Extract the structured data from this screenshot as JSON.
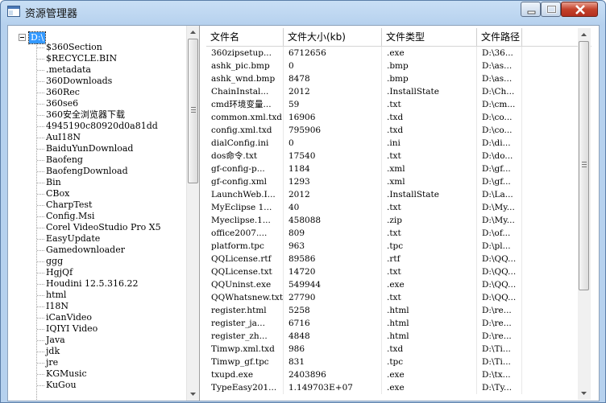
{
  "window": {
    "title": "资源管理器"
  },
  "tree": {
    "root": "D:\\",
    "items": [
      "$360Section",
      "$RECYCLE.BIN",
      ".metadata",
      "360Downloads",
      "360Rec",
      "360se6",
      "360安全浏览器下载",
      "4945190c80920d0a81dd",
      "AuI18N",
      "BaiduYunDownload",
      "Baofeng",
      "BaofengDownload",
      "Bin",
      "CBox",
      "CharpTest",
      "Config.Msi",
      "Corel VideoStudio Pro X5",
      "EasyUpdate",
      "Gamedownloader",
      "ggg",
      "HgjQf",
      "Houdini 12.5.316.22",
      "html",
      "I18N",
      "iCanVideo",
      "IQIYI Video",
      "Java",
      "jdk",
      "jre",
      "KGMusic",
      "KuGou"
    ]
  },
  "grid": {
    "columns": [
      "文件名",
      "文件大小(kb)",
      "文件类型",
      "文件路径"
    ],
    "rows": [
      [
        "360zipsetup...",
        "6712656",
        ".exe",
        "D:\\36..."
      ],
      [
        "ashk_pic.bmp",
        "0",
        ".bmp",
        "D:\\as..."
      ],
      [
        "ashk_wnd.bmp",
        "8478",
        ".bmp",
        "D:\\as..."
      ],
      [
        "ChainInstal...",
        "2012",
        ".InstallState",
        "D:\\Ch..."
      ],
      [
        "cmd环境变量...",
        "59",
        ".txt",
        "D:\\cm..."
      ],
      [
        "common.xml.txd",
        "16906",
        ".txd",
        "D:\\co..."
      ],
      [
        "config.xml.txd",
        "795906",
        ".txd",
        "D:\\co..."
      ],
      [
        "dialConfig.ini",
        "0",
        ".ini",
        "D:\\di..."
      ],
      [
        "dos命令.txt",
        "17540",
        ".txt",
        "D:\\do..."
      ],
      [
        "gf-config-p...",
        "1184",
        ".xml",
        "D:\\gf..."
      ],
      [
        "gf-config.xml",
        "1293",
        ".xml",
        "D:\\gf..."
      ],
      [
        "LaunchWeb.I...",
        "2012",
        ".InstallState",
        "D:\\La..."
      ],
      [
        "MyEclipse 1...",
        "40",
        ".txt",
        "D:\\My..."
      ],
      [
        "Myeclipse.1...",
        "458088",
        ".zip",
        "D:\\My..."
      ],
      [
        "office2007....",
        "809",
        ".txt",
        "D:\\of..."
      ],
      [
        "platform.tpc",
        "963",
        ".tpc",
        "D:\\pl..."
      ],
      [
        "QQLicense.rtf",
        "89586",
        ".rtf",
        "D:\\QQ..."
      ],
      [
        "QQLicense.txt",
        "14720",
        ".txt",
        "D:\\QQ..."
      ],
      [
        "QQUninst.exe",
        "549944",
        ".exe",
        "D:\\QQ..."
      ],
      [
        "QQWhatsnew.txt",
        "27790",
        ".txt",
        "D:\\QQ..."
      ],
      [
        "register.html",
        "5258",
        ".html",
        "D:\\re..."
      ],
      [
        "register_ja...",
        "6716",
        ".html",
        "D:\\re..."
      ],
      [
        "register_zh...",
        "4848",
        ".html",
        "D:\\re..."
      ],
      [
        "Timwp.xml.txd",
        "986",
        ".txd",
        "D:\\Ti..."
      ],
      [
        "Timwp_gf.tpc",
        "831",
        ".tpc",
        "D:\\Ti..."
      ],
      [
        "txupd.exe",
        "2403896",
        ".exe",
        "D:\\tx..."
      ],
      [
        "TypeEasy201...",
        "1.149703E+07",
        ".exe",
        "D:\\Ty..."
      ]
    ]
  }
}
